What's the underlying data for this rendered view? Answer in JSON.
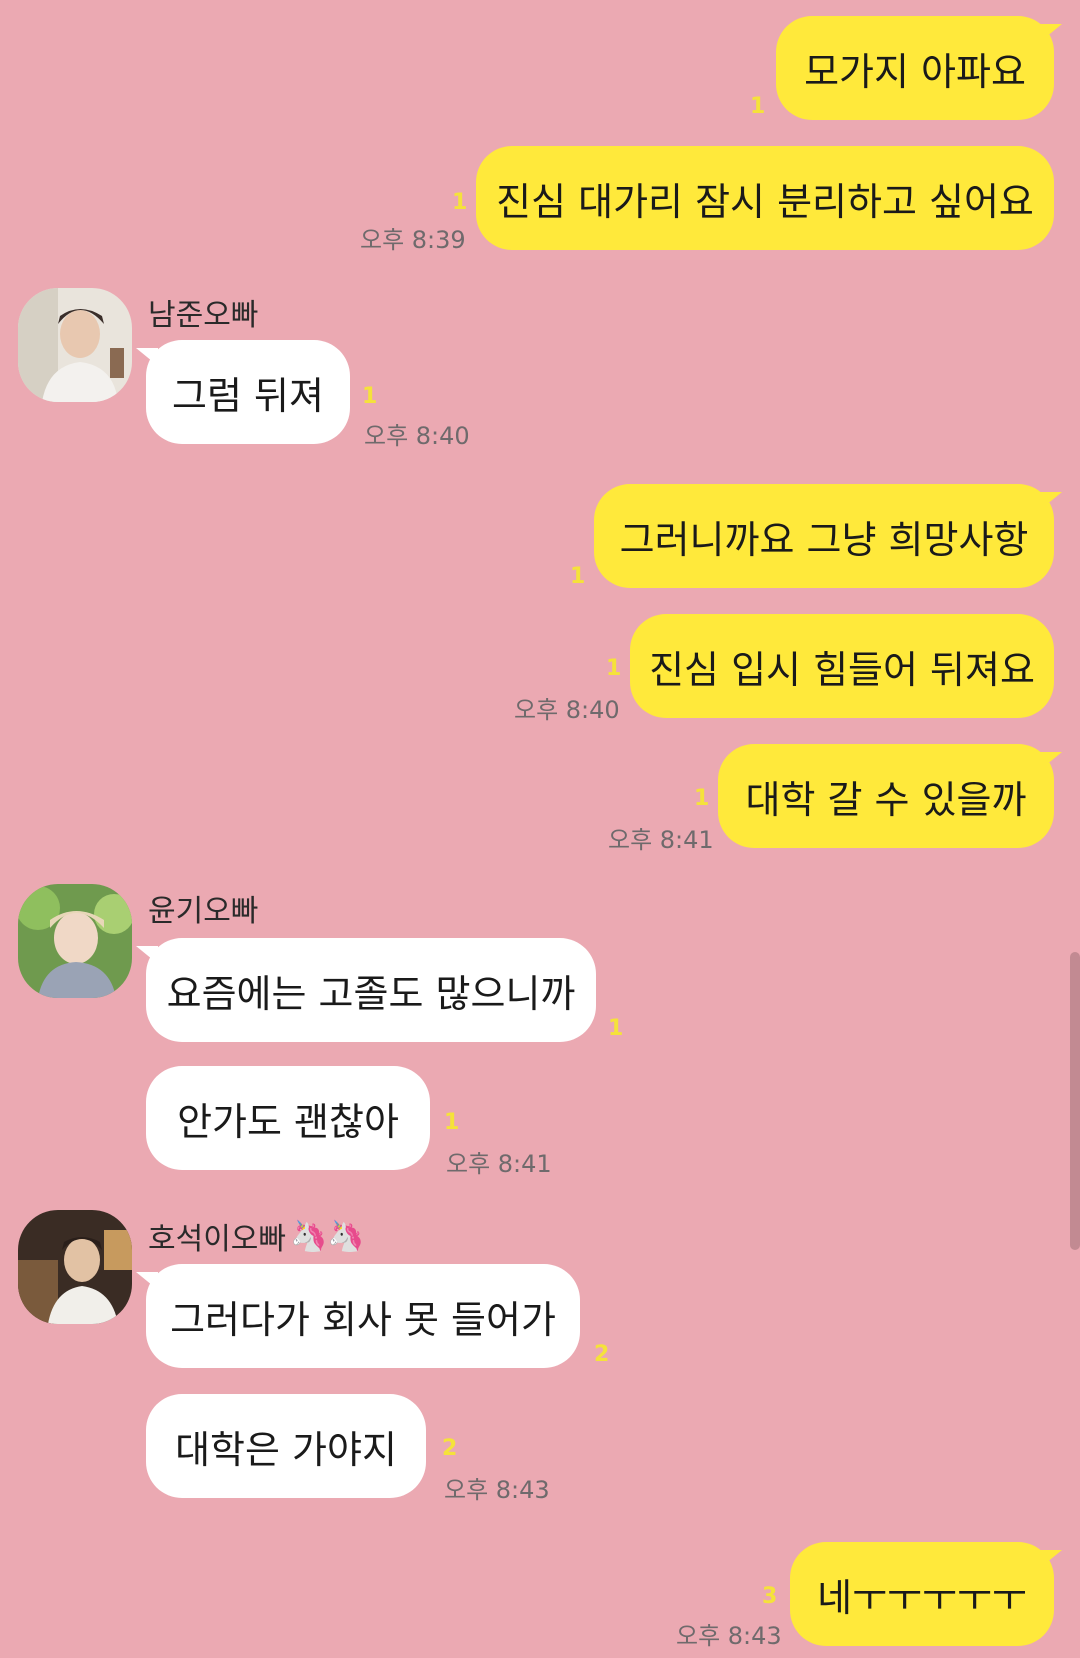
{
  "theme": {
    "background": "#eba9b2",
    "mine_bubble": "#ffe93b",
    "their_bubble": "#ffffff",
    "unread_color": "#f5e23a"
  },
  "messages": {
    "m1": {
      "text": "모가지 아파요",
      "unread": "1"
    },
    "m2": {
      "text": "진심 대가리 잠시 분리하고 싶어요",
      "unread": "1",
      "time": "오후 8:39"
    },
    "m3": {
      "sender": "남준오빠",
      "text": "그럼 뒤져",
      "unread": "1",
      "time": "오후 8:40"
    },
    "m4": {
      "text": "그러니까요 그냥 희망사항",
      "unread": "1"
    },
    "m5": {
      "text": "진심 입시 힘들어 뒤져요",
      "unread": "1",
      "time": "오후 8:40"
    },
    "m6": {
      "text": "대학 갈 수 있을까",
      "unread": "1",
      "time": "오후 8:41"
    },
    "m7": {
      "sender": "윤기오빠",
      "text": "요즘에는 고졸도 많으니까",
      "unread": "1"
    },
    "m8": {
      "text": "안가도 괜찮아",
      "unread": "1",
      "time": "오후 8:41"
    },
    "m9": {
      "sender": "호석이오빠",
      "sender_emoji": "🦄🦄",
      "text": "그러다가 회사 못 들어가",
      "unread": "2"
    },
    "m10": {
      "text": "대학은 가야지",
      "unread": "2",
      "time": "오후 8:43"
    },
    "m11": {
      "text": "네ㅜㅜㅜㅜㅜ",
      "unread": "3",
      "time": "오후 8:43"
    }
  }
}
